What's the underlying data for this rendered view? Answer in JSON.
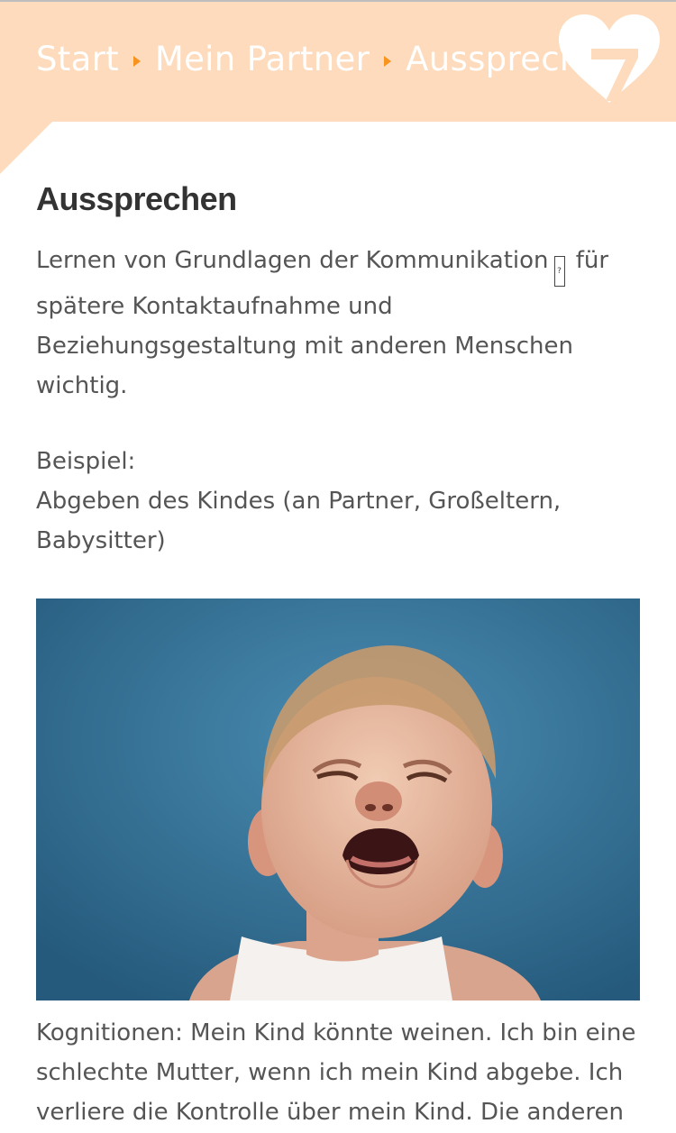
{
  "breadcrumb": {
    "items": [
      "Start",
      "Mein Partner",
      "Aussprechen"
    ]
  },
  "logo": {
    "name": "heart-7-logo-icon"
  },
  "article": {
    "title": "Aussprechen",
    "intro_before": "Lernen von Grundlagen der Kommunikation",
    "intro_after": " für spätere Kontaktaufnahme und Beziehungsgestaltung mit anderen Menschen wichtig.",
    "example_label": "Beispiel:",
    "example_text": "Abgeben des Kindes (an Partner, Großeltern, Babysitter)",
    "image_alt_semantic": "crying-baby-photo",
    "caption": "Kognitionen: Mein Kind könnte weinen. Ich bin eine schlechte Mutter, wenn ich mein Kind abgebe. Ich verliere die Kontrolle über mein Kind. Die anderen"
  },
  "colors": {
    "header_bg": "#fddbbc",
    "accent": "#f7931e",
    "photo_bg": "#2f6f94"
  }
}
